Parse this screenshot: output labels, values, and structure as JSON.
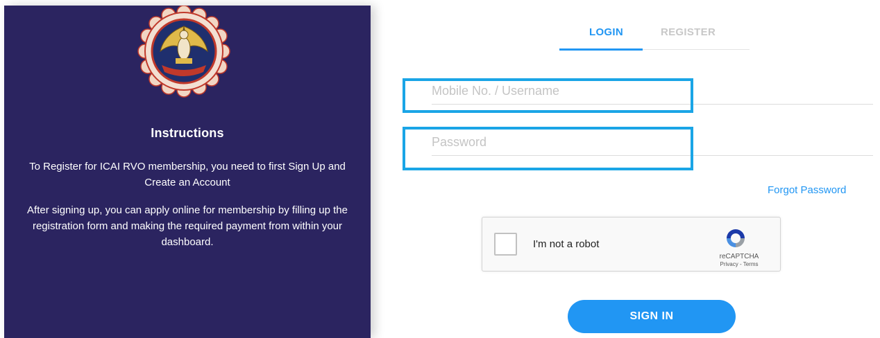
{
  "left_panel": {
    "instructions_title": "Instructions",
    "paragraph_1": "To Register for ICAI RVO membership, you need to first Sign Up and Create an Account",
    "paragraph_2": "After signing up, you can apply online for membership by filling up the registration form and making the required payment from within your dashboard."
  },
  "tabs": [
    {
      "label": "LOGIN",
      "active": true
    },
    {
      "label": "REGISTER",
      "active": false
    }
  ],
  "form": {
    "username_placeholder": "Mobile No. / Username",
    "username_value": "",
    "password_placeholder": "Password",
    "password_value": "",
    "forgot_password": "Forgot Password"
  },
  "recaptcha": {
    "label": "I'm not a robot",
    "brand": "reCAPTCHA",
    "links": "Privacy - Terms",
    "checked": false
  },
  "signin_label": "SIGN IN",
  "colors": {
    "panel_bg": "#2b2460",
    "accent": "#2196f3",
    "highlight": "#1aa5e6"
  }
}
